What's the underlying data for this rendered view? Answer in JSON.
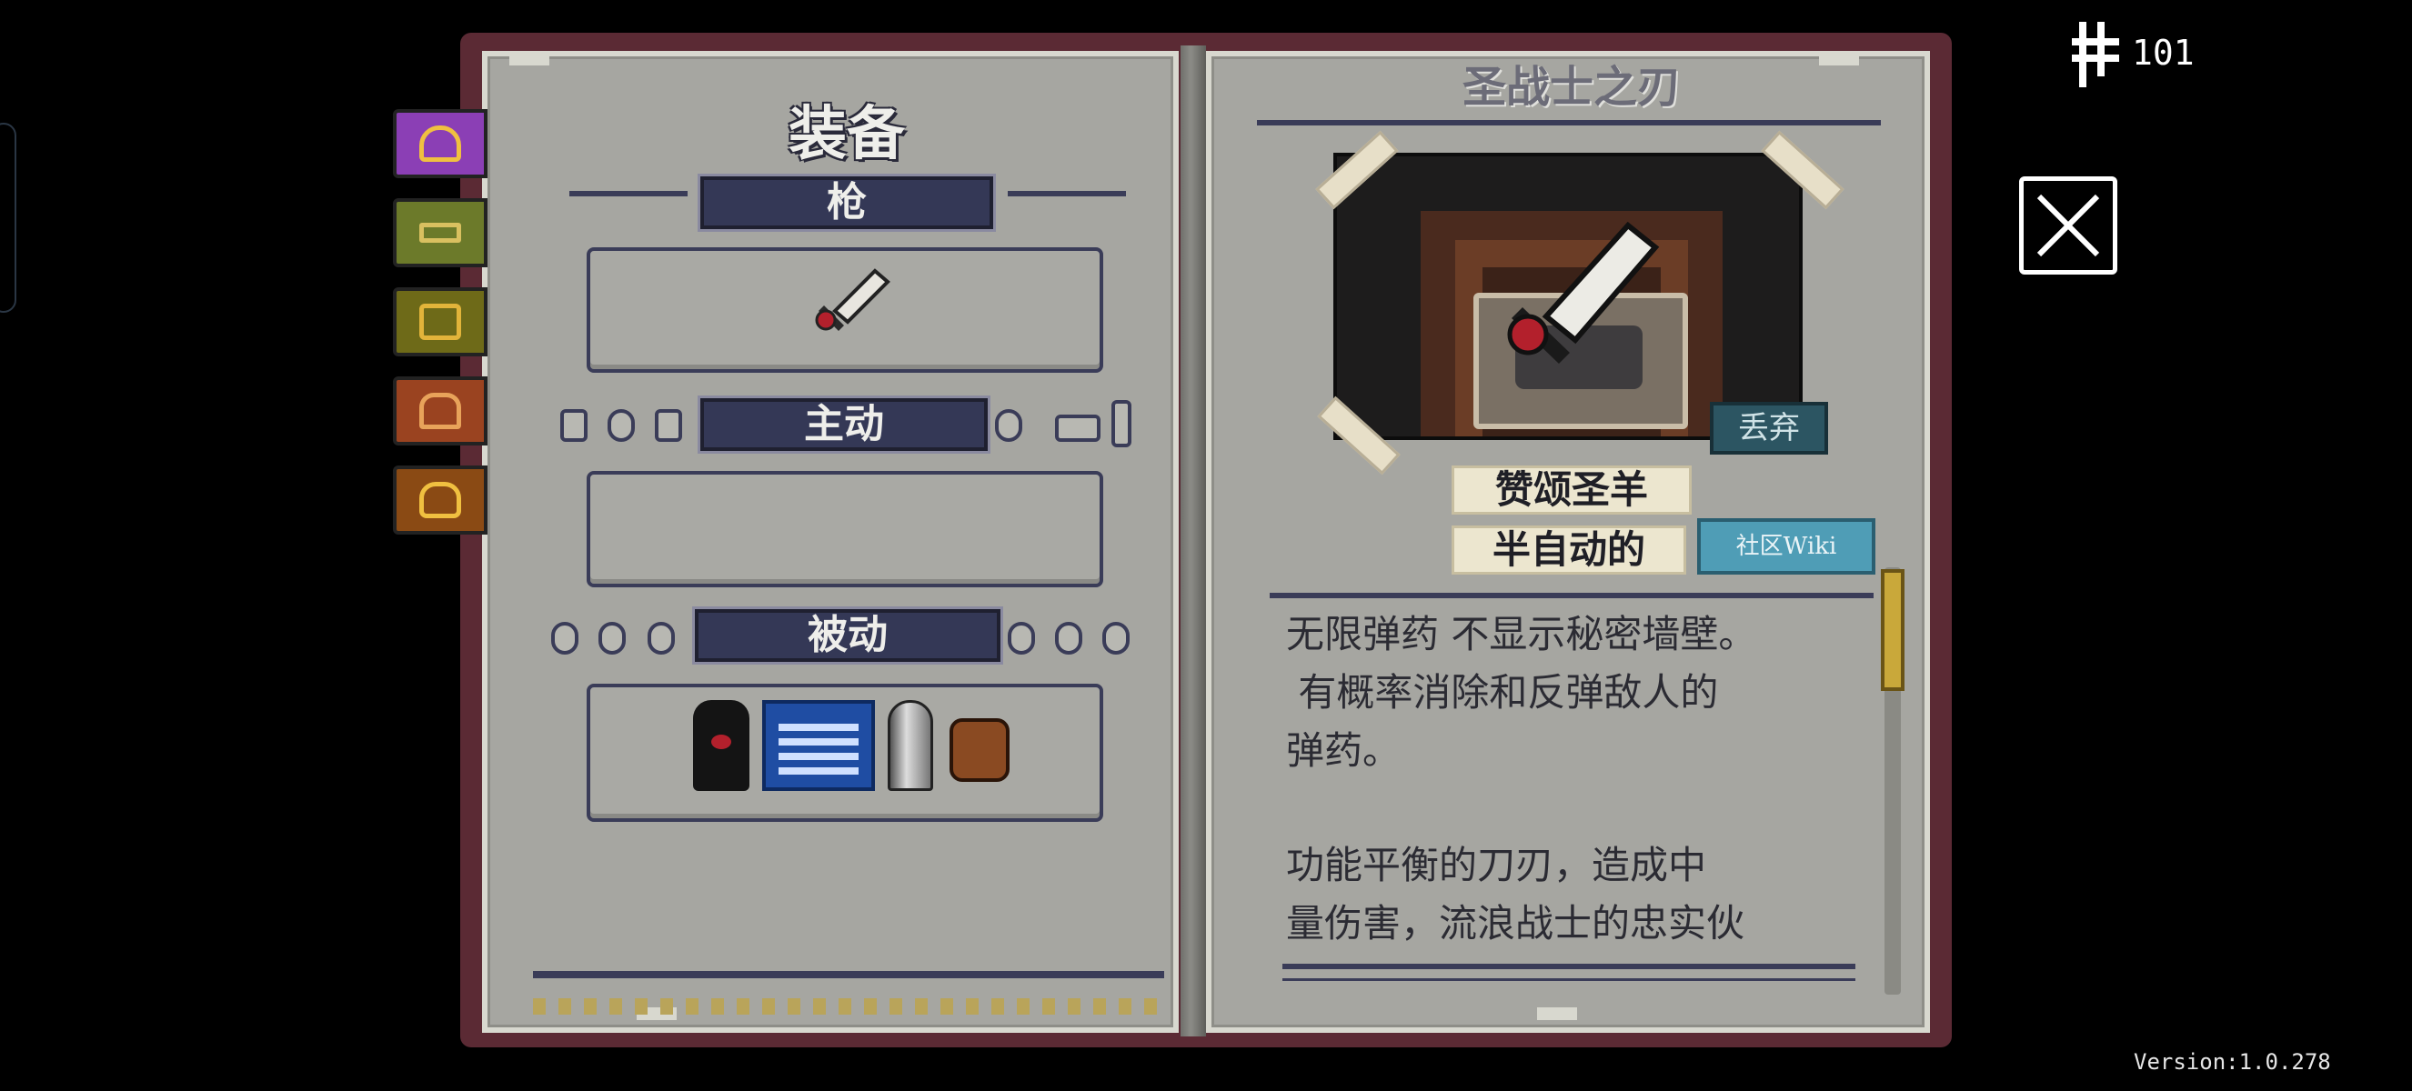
{
  "hud": {
    "currency_value": "101",
    "currency_icon": "key-currency-icon",
    "close_icon": "close-icon",
    "version": "Version:1.0.278"
  },
  "tabs": [
    {
      "name": "helmet-icon",
      "color": "#8b3fb5",
      "selected": true
    },
    {
      "name": "gun-icon",
      "color": "#6c7a2a",
      "selected": false
    },
    {
      "name": "chest-icon",
      "color": "#6e6a18",
      "selected": false
    },
    {
      "name": "npc-icon",
      "color": "#9a4320",
      "selected": false
    },
    {
      "name": "skull-icon",
      "color": "#8a4a14",
      "selected": false
    }
  ],
  "equipment": {
    "title": "装备",
    "gun_label": "枪",
    "active_label": "主动",
    "passive_label": "被动",
    "gun_items": [
      "sword-icon"
    ],
    "passive_items": [
      "hood-icon",
      "map-icon",
      "bullet-icon",
      "bag-icon"
    ]
  },
  "item": {
    "name": "圣战士之刃",
    "discard_label": "丢弃",
    "tags": [
      "赞颂圣羊",
      "半自动的"
    ],
    "wiki_label": "社区Wiki",
    "description_1": "无限弹药 不显示秘密墙壁。\n 有概率消除和反弹敌人的\n弹药。",
    "description_2": "功能平衡的刀刃，造成中\n量伤害，流浪战士的忠实伙"
  },
  "colors": {
    "book_border": "#5b2a34",
    "page": "#a6a6a1",
    "label_bg": "#343856",
    "wiki_bg": "#4f9db6",
    "discard_bg": "#2c5562"
  }
}
